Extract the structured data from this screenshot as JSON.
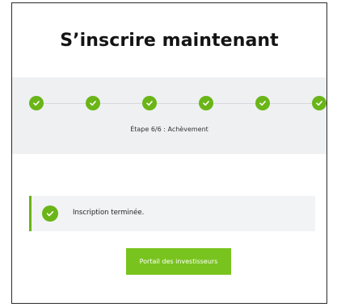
{
  "page_title": "S’inscrire maintenant",
  "progress": {
    "current_step": 6,
    "total_steps": 6,
    "step_label": "Étape 6/6 : Achèvement",
    "steps": [
      {
        "status": "complete",
        "icon": "checkmark-icon"
      },
      {
        "status": "complete",
        "icon": "checkmark-icon"
      },
      {
        "status": "complete",
        "icon": "checkmark-icon"
      },
      {
        "status": "complete",
        "icon": "checkmark-icon"
      },
      {
        "status": "complete",
        "icon": "checkmark-icon"
      },
      {
        "status": "complete",
        "icon": "checkmark-icon"
      }
    ]
  },
  "alert": {
    "icon": "success-check-icon",
    "message": "Inscription terminée."
  },
  "buttons": {
    "portal_label": "Portail des investisseurs"
  },
  "colors": {
    "accent": "#6ab517",
    "button": "#79c31e",
    "panel": "#eef0f2"
  }
}
